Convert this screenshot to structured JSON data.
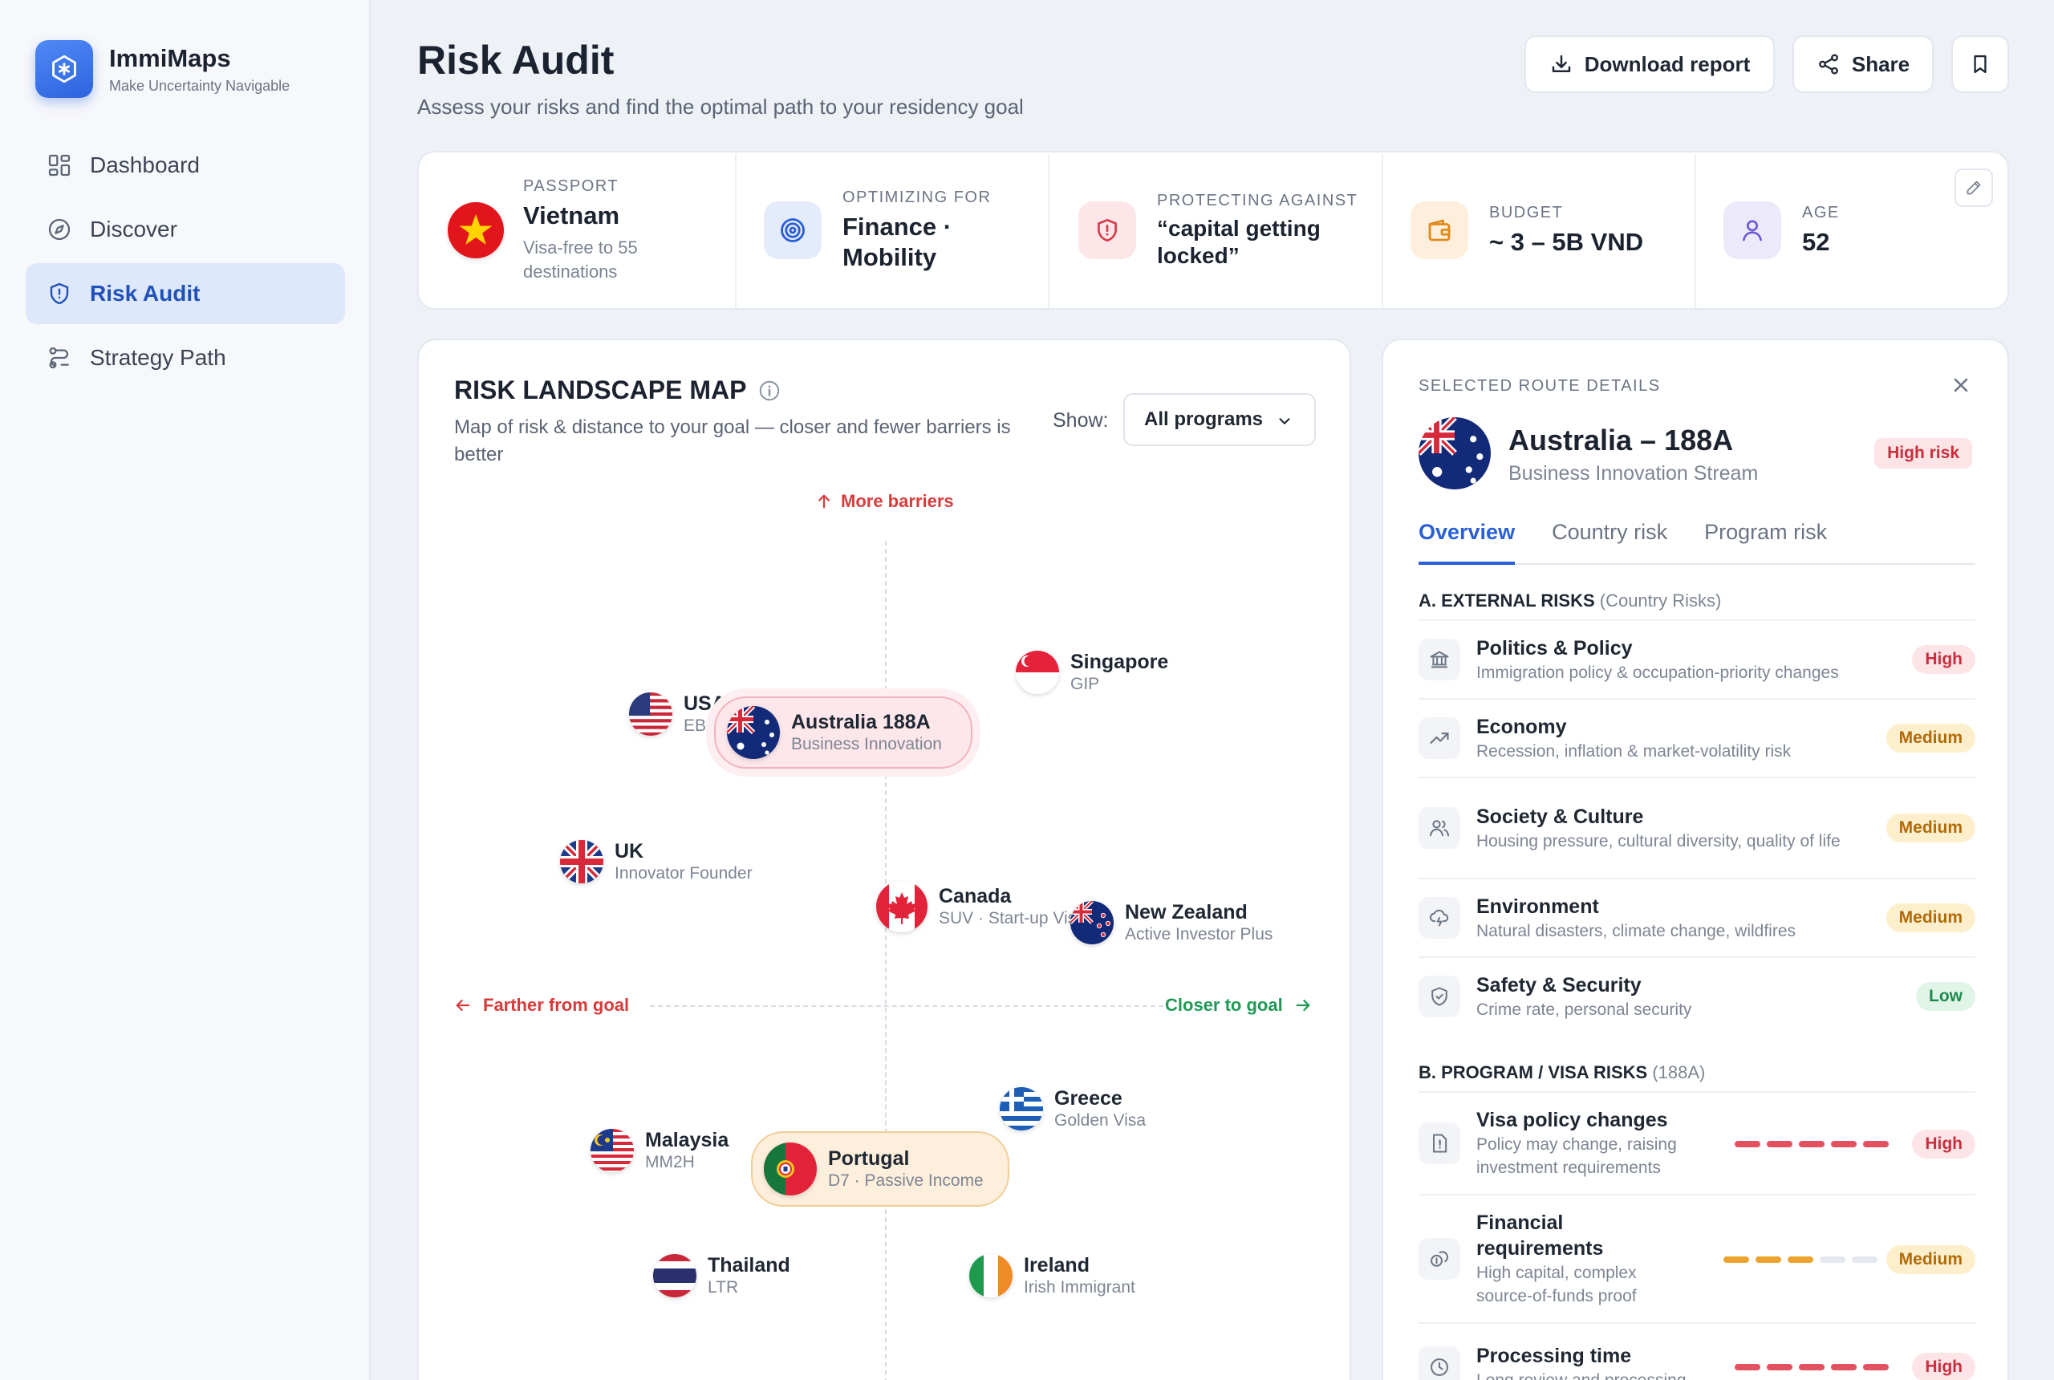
{
  "brand": {
    "name": "ImmiMaps",
    "tagline": "Make Uncertainty Navigable"
  },
  "nav": [
    {
      "label": "Dashboard",
      "icon": "grid-icon",
      "active": false
    },
    {
      "label": "Discover",
      "icon": "compass-icon",
      "active": false
    },
    {
      "label": "Risk Audit",
      "icon": "shield-icon",
      "active": true
    },
    {
      "label": "Strategy Path",
      "icon": "route-icon",
      "active": false
    }
  ],
  "header": {
    "title": "Risk Audit",
    "subtitle": "Assess your risks and find the optimal path to your residency goal",
    "download_label": "Download report",
    "share_label": "Share"
  },
  "profile": {
    "passport": {
      "label": "PASSPORT",
      "value": "Vietnam",
      "sub": "Visa-free to 55 destinations"
    },
    "optimizing": {
      "label": "OPTIMIZING FOR",
      "value": "Finance · Mobility"
    },
    "protecting": {
      "label": "PROTECTING AGAINST",
      "value": "“capital getting locked”"
    },
    "budget": {
      "label": "BUDGET",
      "value": "~ 3 – 5B VND"
    },
    "age": {
      "label": "AGE",
      "value": "52"
    }
  },
  "map": {
    "title": "RISK LANDSCAPE MAP",
    "description": "Map of risk & distance to your goal — closer and fewer barriers is better",
    "show_label": "Show:",
    "filter_value": "All programs",
    "axis_top": "More barriers",
    "axis_left": "Farther from goal",
    "axis_right": "Closer to goal",
    "points": {
      "usa": {
        "name": "USA",
        "program": "EB-5"
      },
      "australia": {
        "name": "Australia 188A",
        "program": "Business Innovation"
      },
      "singapore": {
        "name": "Singapore",
        "program": "GIP"
      },
      "uk": {
        "name": "UK",
        "program": "Innovator Founder"
      },
      "canada": {
        "name": "Canada",
        "program": "SUV · Start-up Visa"
      },
      "newzealand": {
        "name": "New Zealand",
        "program": "Active Investor Plus"
      },
      "greece": {
        "name": "Greece",
        "program": "Golden Visa"
      },
      "malaysia": {
        "name": "Malaysia",
        "program": "MM2H"
      },
      "portugal": {
        "name": "Portugal",
        "program": "D7 · Passive Income"
      },
      "thailand": {
        "name": "Thailand",
        "program": "LTR"
      },
      "ireland": {
        "name": "Ireland",
        "program": "Irish Immigrant"
      }
    }
  },
  "details": {
    "eyebrow": "SELECTED ROUTE DETAILS",
    "name": "Australia – 188A",
    "stream": "Business Innovation Stream",
    "risk_badge": "High risk",
    "tabs": [
      "Overview",
      "Country risk",
      "Program risk"
    ],
    "external_head": "A. EXTERNAL RISKS",
    "external_head_muted": "(Country Risks)",
    "external": [
      {
        "title": "Politics & Policy",
        "desc": "Immigration policy & occupation-priority changes",
        "level": "High",
        "icon": "bank-icon"
      },
      {
        "title": "Economy",
        "desc": "Recession, inflation & market-volatility risk",
        "level": "Medium",
        "icon": "trend-icon"
      },
      {
        "title": "Society & Culture",
        "desc": "Housing pressure, cultural diversity, quality of life",
        "level": "Medium",
        "icon": "people-icon"
      },
      {
        "title": "Environment",
        "desc": "Natural disasters, climate change, wildfires",
        "level": "Medium",
        "icon": "cloud-icon"
      },
      {
        "title": "Safety & Security",
        "desc": "Crime rate, personal security",
        "level": "Low",
        "icon": "shield-check-icon"
      }
    ],
    "program_head": "B. PROGRAM / VISA RISKS",
    "program_head_muted": "(188A)",
    "program": [
      {
        "title": "Visa policy changes",
        "desc": "Policy may change, raising investment requirements",
        "level": "High",
        "score": 5,
        "icon": "document-alert-icon"
      },
      {
        "title": "Financial requirements",
        "desc": "High capital, complex source-of-funds proof",
        "level": "Medium",
        "score": 3,
        "icon": "coins-icon"
      },
      {
        "title": "Processing time",
        "desc": "Long review and processing",
        "level": "High",
        "score": 5,
        "icon": "clock-icon"
      }
    ]
  }
}
